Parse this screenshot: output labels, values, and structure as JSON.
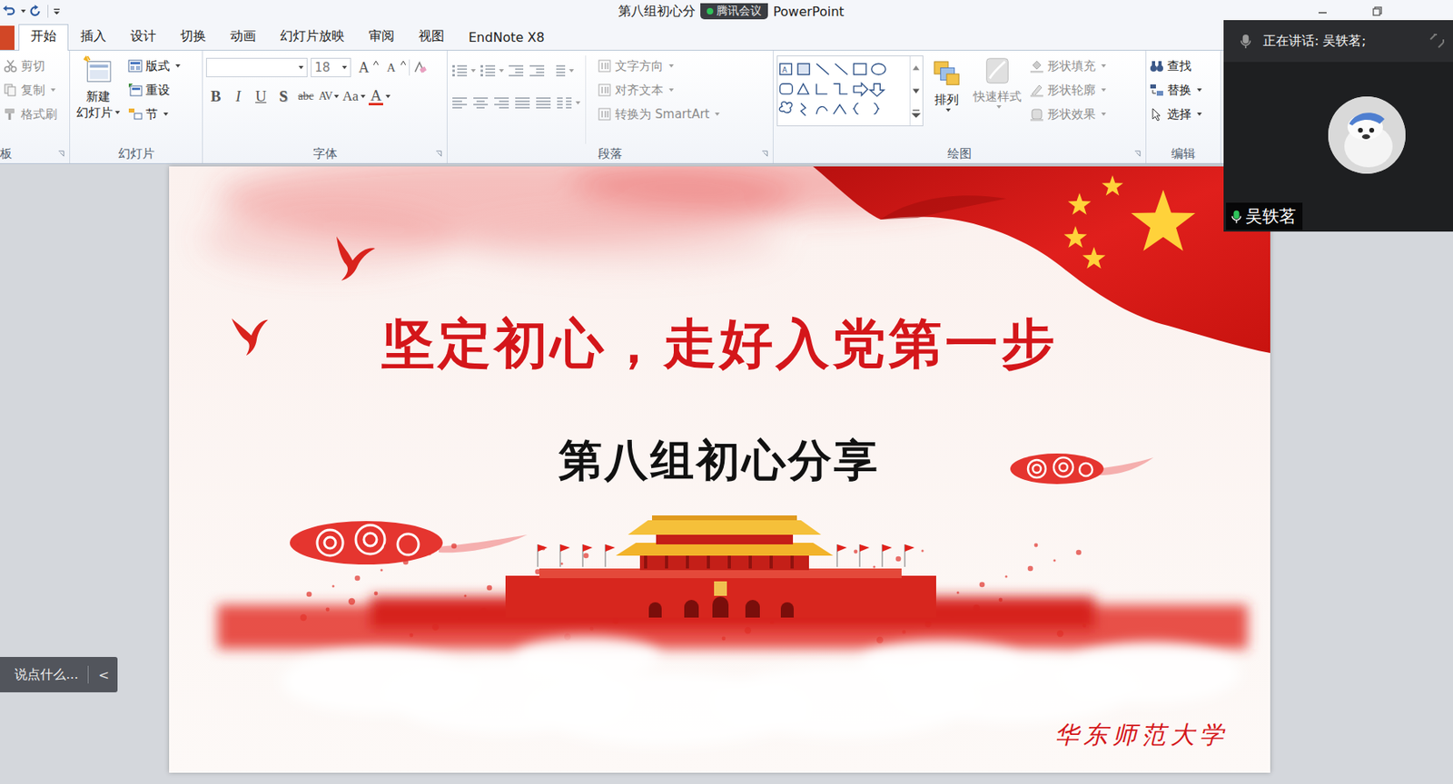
{
  "window": {
    "title_left": "第八组初心分",
    "meeting_badge": "腾讯会议",
    "title_right": "PowerPoint"
  },
  "tabs": [
    {
      "label": "开始",
      "selected": true
    },
    {
      "label": "插入",
      "selected": false
    },
    {
      "label": "设计",
      "selected": false
    },
    {
      "label": "切换",
      "selected": false
    },
    {
      "label": "动画",
      "selected": false
    },
    {
      "label": "幻灯片放映",
      "selected": false
    },
    {
      "label": "审阅",
      "selected": false
    },
    {
      "label": "视图",
      "selected": false
    },
    {
      "label": "EndNote X8",
      "selected": false
    }
  ],
  "ribbon": {
    "clipboard": {
      "label": "板",
      "items": [
        {
          "label": "剪切",
          "disabled": true
        },
        {
          "label": "复制",
          "disabled": true
        },
        {
          "label": "格式刷",
          "disabled": true
        }
      ]
    },
    "slides": {
      "label": "幻灯片",
      "new_slide": [
        "新建",
        "幻灯片"
      ],
      "items": [
        {
          "label": "版式",
          "disabled": false,
          "menu": true
        },
        {
          "label": "重设",
          "disabled": false,
          "menu": false
        },
        {
          "label": "节",
          "disabled": false,
          "menu": true
        }
      ]
    },
    "font": {
      "label": "字体",
      "font_size": "18",
      "size_buttons": [
        "A",
        "A"
      ],
      "buttons": [
        {
          "text": "B",
          "kind": "bold",
          "menu": false
        },
        {
          "text": "I",
          "kind": "italic",
          "menu": false
        },
        {
          "text": "U",
          "kind": "underline",
          "menu": false
        },
        {
          "text": "S",
          "kind": "shadow",
          "menu": false
        },
        {
          "text": "abc",
          "kind": "strike",
          "menu": false
        },
        {
          "text": "AV",
          "kind": "spacing",
          "menu": true
        },
        {
          "text": "Aa",
          "kind": "case",
          "menu": true
        },
        {
          "text": "A",
          "kind": "color",
          "menu": true
        }
      ]
    },
    "paragraph": {
      "label": "段落",
      "items": [
        {
          "label": "文字方向",
          "disabled": true
        },
        {
          "label": "对齐文本",
          "disabled": true
        },
        {
          "label": "转换为 SmartArt",
          "disabled": true
        }
      ]
    },
    "drawing": {
      "label": "绘图",
      "arrange": "排列",
      "quick_styles": {
        "label": "快速样式",
        "disabled": true
      },
      "items": [
        {
          "label": "形状填充",
          "disabled": true
        },
        {
          "label": "形状轮廓",
          "disabled": true
        },
        {
          "label": "形状效果",
          "disabled": true
        }
      ]
    },
    "editing": {
      "label": "编辑",
      "items": [
        {
          "label": "查找",
          "disabled": false,
          "menu": false
        },
        {
          "label": "替换",
          "disabled": false,
          "menu": true
        },
        {
          "label": "选择",
          "disabled": false,
          "menu": true
        }
      ]
    }
  },
  "slide": {
    "title": "坚定初心，走好入党第一步",
    "subtitle": "第八组初心分享",
    "footer": "华东师范大学"
  },
  "meeting": {
    "speaking": "正在讲话: 吴轶茗;",
    "participant": "吴轶茗",
    "mic_on": true
  },
  "chat": {
    "placeholder": "说点什么...",
    "toggle": "<"
  }
}
